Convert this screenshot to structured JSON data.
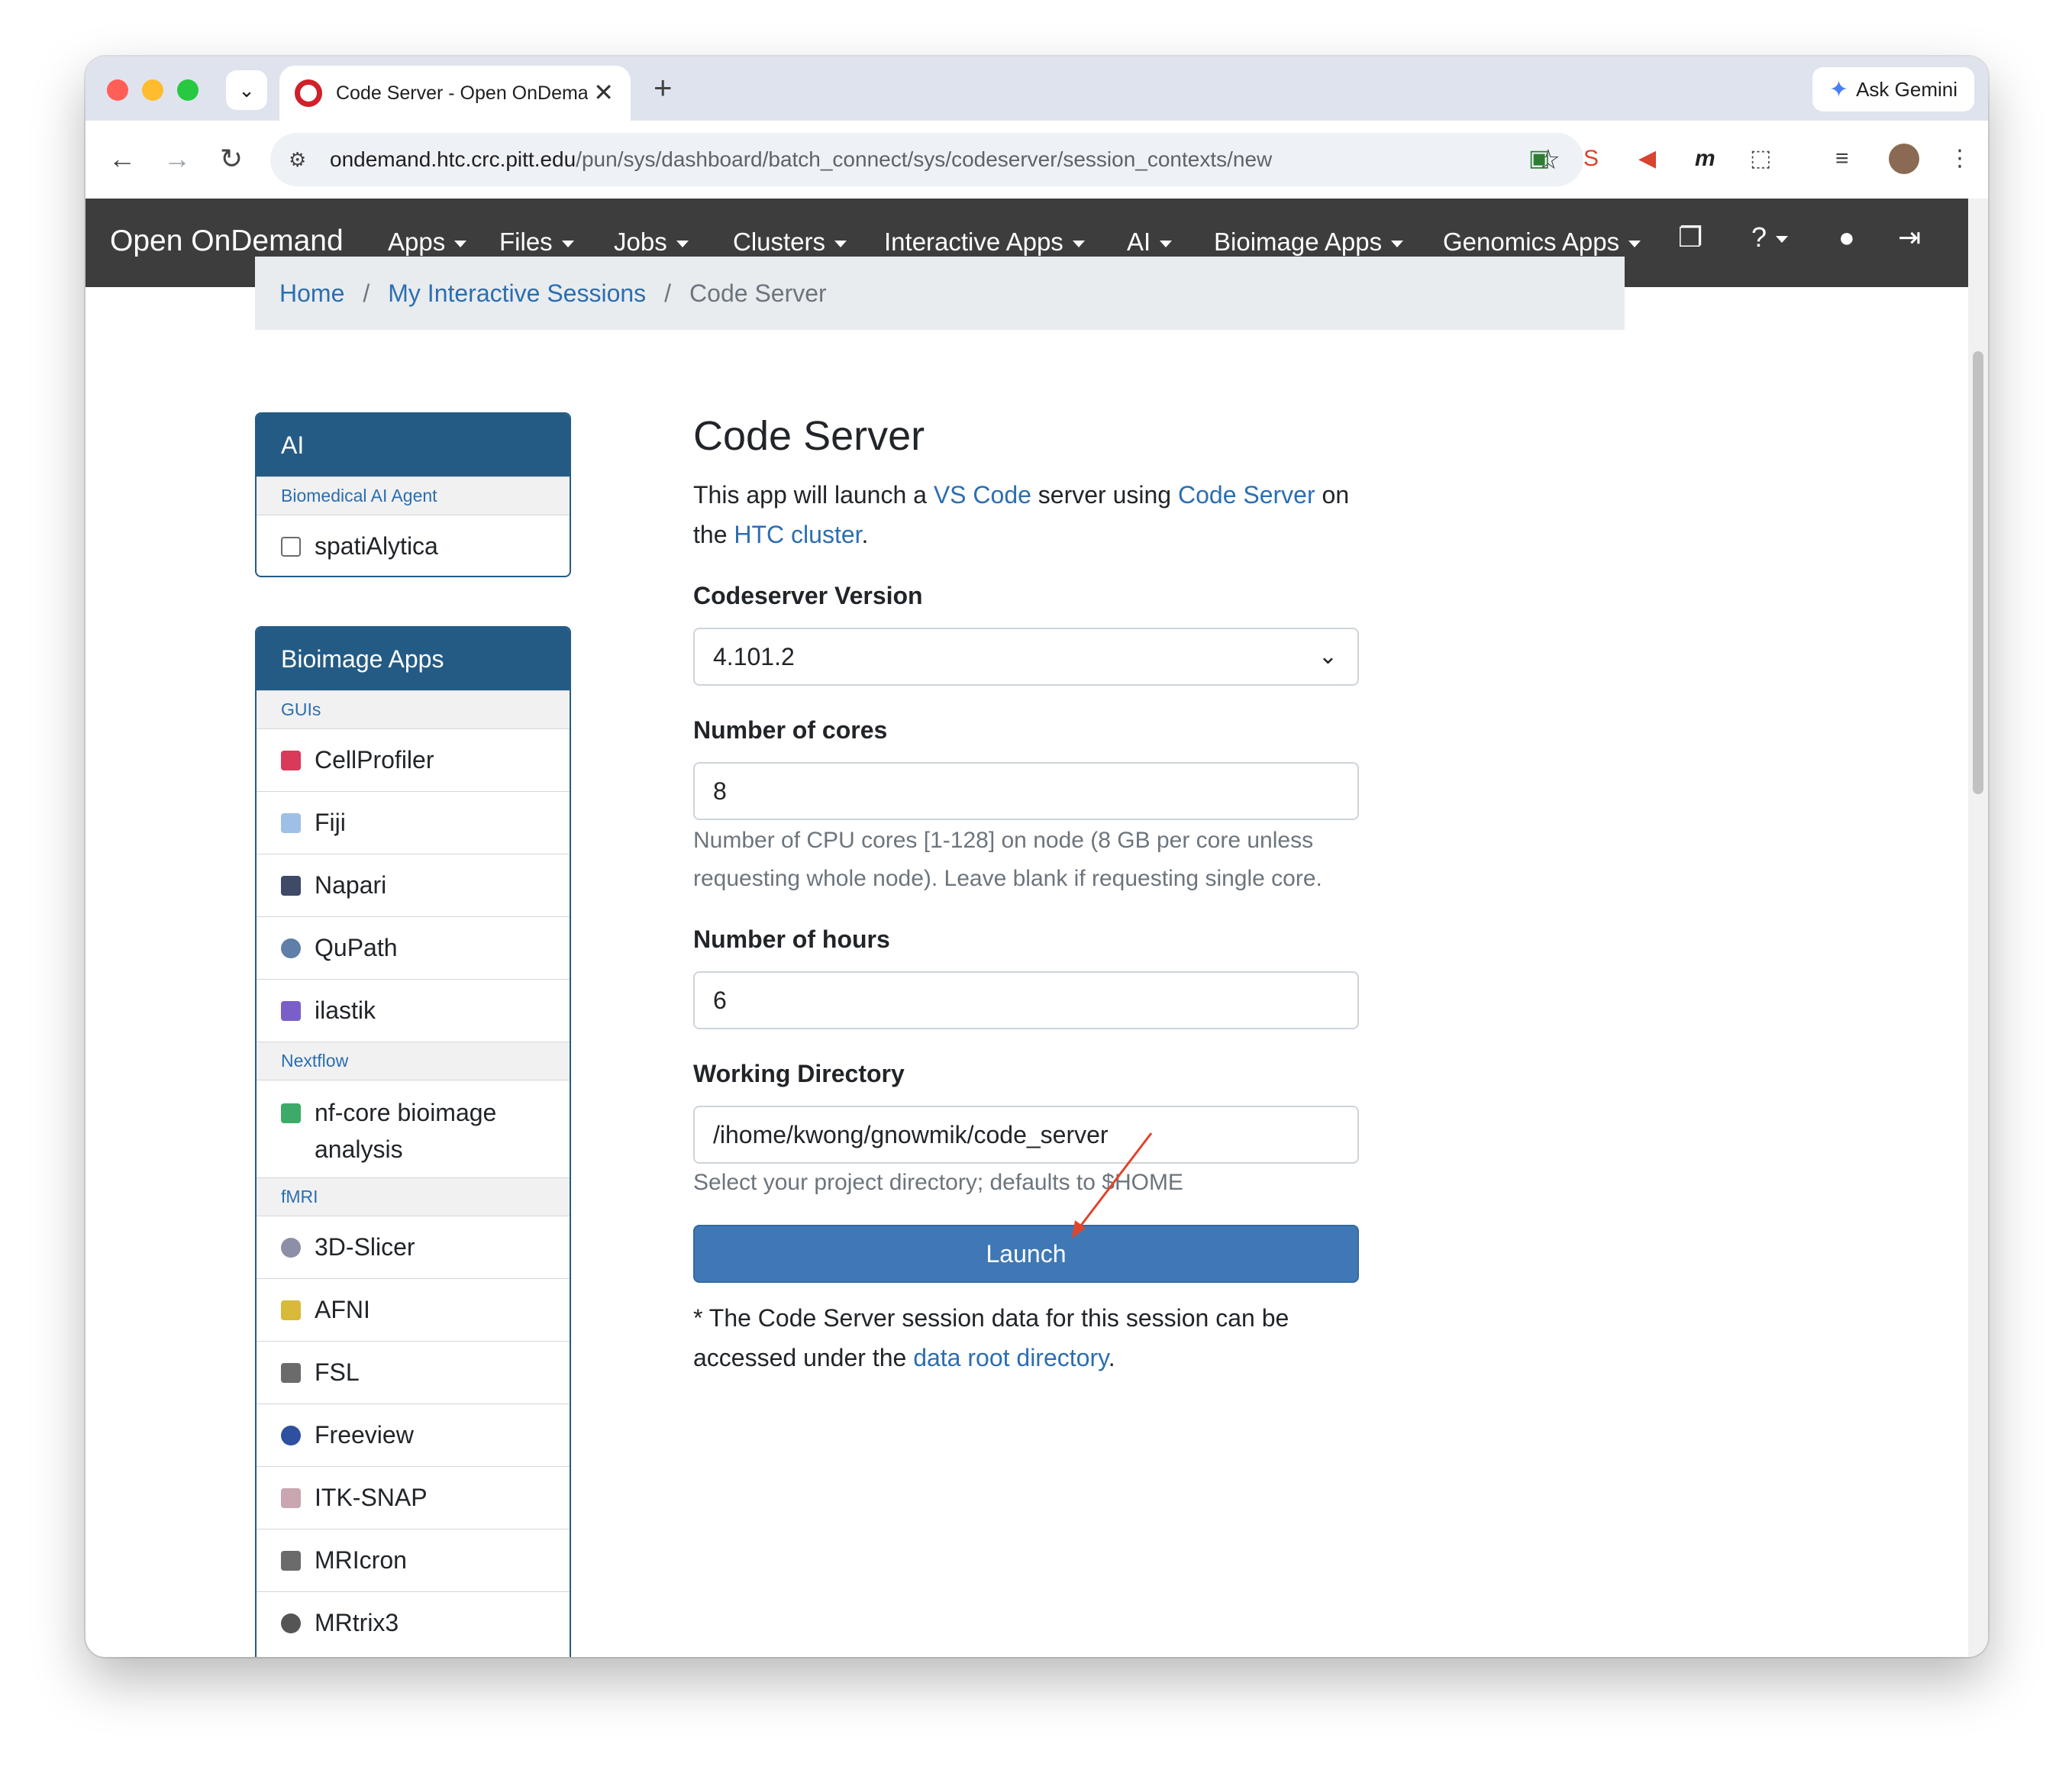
{
  "browser": {
    "tab_title": "Code Server - Open OnDemand",
    "ask_gemini": "Ask Gemini",
    "url_host": "ondemand.htc.crc.pitt.edu",
    "url_path": "/pun/sys/dashboard/batch_connect/sys/codeserver/session_contexts/new",
    "new_tab_glyph": "+",
    "close_glyph": "✕"
  },
  "navbar": {
    "brand": "Open OnDemand",
    "items": [
      "Apps",
      "Files",
      "Jobs",
      "Clusters",
      "Interactive Apps",
      "AI",
      "Bioimage Apps",
      "Genomics Apps"
    ],
    "icons": [
      "sessions-icon",
      "help-icon",
      "user-icon",
      "logout-icon"
    ]
  },
  "breadcrumb": {
    "home": "Home",
    "sessions": "My Interactive Sessions",
    "current": "Code Server",
    "separator": "/"
  },
  "sidebar": {
    "ai_panel": {
      "title": "AI",
      "group": "Biomedical AI Agent",
      "items": [
        "spatiAlytica"
      ]
    },
    "bioimage_panel": {
      "title": "Bioimage Apps",
      "group_guis": "GUIs",
      "guis": [
        "CellProfiler",
        "Fiji",
        "Napari",
        "QuPath",
        "ilastik"
      ],
      "group_nextflow": "Nextflow",
      "nextflow": [
        "nf-core bioimage analysis"
      ],
      "group_fmri": "fMRI",
      "fmri": [
        "3D-Slicer",
        "AFNI",
        "FSL",
        "Freeview",
        "ITK-SNAP",
        "MRIcron",
        "MRtrix3"
      ]
    }
  },
  "main": {
    "title": "Code Server",
    "intro_1": "This app will launch a ",
    "intro_link1": "VS Code",
    "intro_2": " server using ",
    "intro_link2": "Code Server",
    "intro_3": " on the ",
    "intro_link3": "HTC cluster",
    "intro_4": ".",
    "version_label": "Codeserver Version",
    "version_value": "4.101.2",
    "cores_label": "Number of cores",
    "cores_value": "8",
    "cores_help": "Number of CPU cores [1-128] on node (8 GB per core unless requesting whole node). Leave blank if requesting single core.",
    "hours_label": "Number of hours",
    "hours_value": "6",
    "dir_label": "Working Directory",
    "dir_value": "/ihome/kwong/gnowmik/code_server",
    "dir_help": "Select your project directory; defaults to $HOME",
    "launch": "Launch",
    "foot_1": "* The Code Server session data for this session can be accessed under the ",
    "foot_link": "data root directory",
    "foot_2": "."
  },
  "colors": {
    "navbar": "#3d3d3d",
    "panel_header": "#245b85",
    "link": "#2c6eb0",
    "launch": "#3f78b5",
    "annotation_arrow": "#e0452b"
  }
}
